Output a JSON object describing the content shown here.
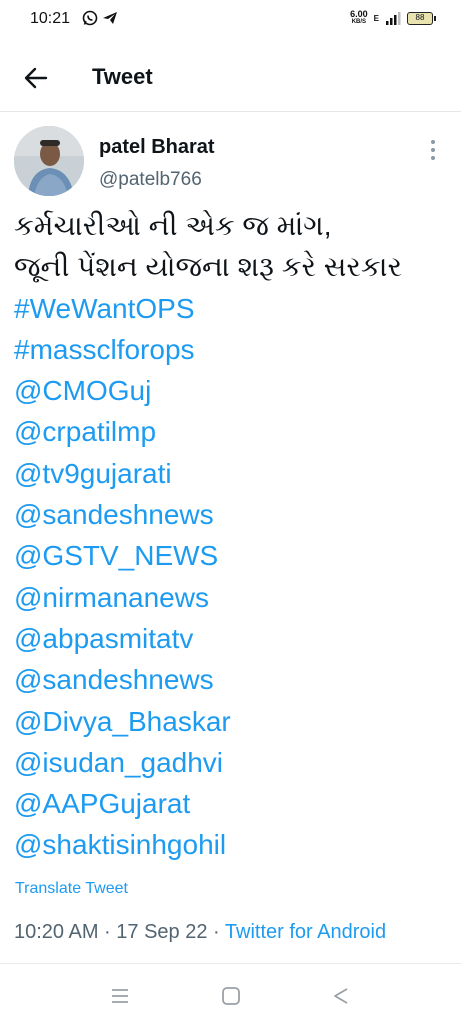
{
  "status_bar": {
    "time": "10:21",
    "left_icons": [
      "whatsapp-icon",
      "telegram-icon"
    ],
    "net_speed_value": "6.00",
    "net_speed_unit": "KB/S",
    "network_type": "E",
    "battery": "88"
  },
  "header": {
    "back_icon": "arrow-left-icon",
    "title": "Tweet"
  },
  "author": {
    "name": "patel Bharat",
    "handle": "@patelb766",
    "more_icon": "vertical-ellipsis-icon"
  },
  "tweet": {
    "lines": [
      {
        "text": "કર્મચારીઓ ની એક જ માંગ,",
        "type": "text"
      },
      {
        "text": "જૂની પેંશન યોજના શરૂ કરે સરકાર",
        "type": "text"
      },
      {
        "text": "#WeWantOPS",
        "type": "link"
      },
      {
        "text": "#massclforops",
        "type": "link"
      },
      {
        "text": "@CMOGuj",
        "type": "link"
      },
      {
        "text": "@crpatilmp",
        "type": "link"
      },
      {
        "text": "@tv9gujarati",
        "type": "link"
      },
      {
        "text": "@sandeshnews",
        "type": "link"
      },
      {
        "text": "@GSTV_NEWS",
        "type": "link"
      },
      {
        "text": "@nirmananews",
        "type": "link"
      },
      {
        "text": "@abpasmitatv",
        "type": "link"
      },
      {
        "text": "@sandeshnews",
        "type": "link"
      },
      {
        "text": "@Divya_Bhaskar",
        "type": "link"
      },
      {
        "text": "@isudan_gadhvi",
        "type": "link"
      },
      {
        "text": "@AAPGujarat",
        "type": "link"
      },
      {
        "text": "@shaktisinhgohil",
        "type": "link"
      }
    ],
    "translate_label": "Translate Tweet",
    "timestamp": "10:20 AM · 17 Sep 22 · ",
    "source": "Twitter for Android"
  },
  "nav_bar": {
    "buttons": [
      "menu-icon",
      "home-square-icon",
      "back-triangle-icon"
    ]
  },
  "colors": {
    "link": "#1d9bf0",
    "secondary_text": "#536471",
    "primary_text": "#0f1419"
  }
}
